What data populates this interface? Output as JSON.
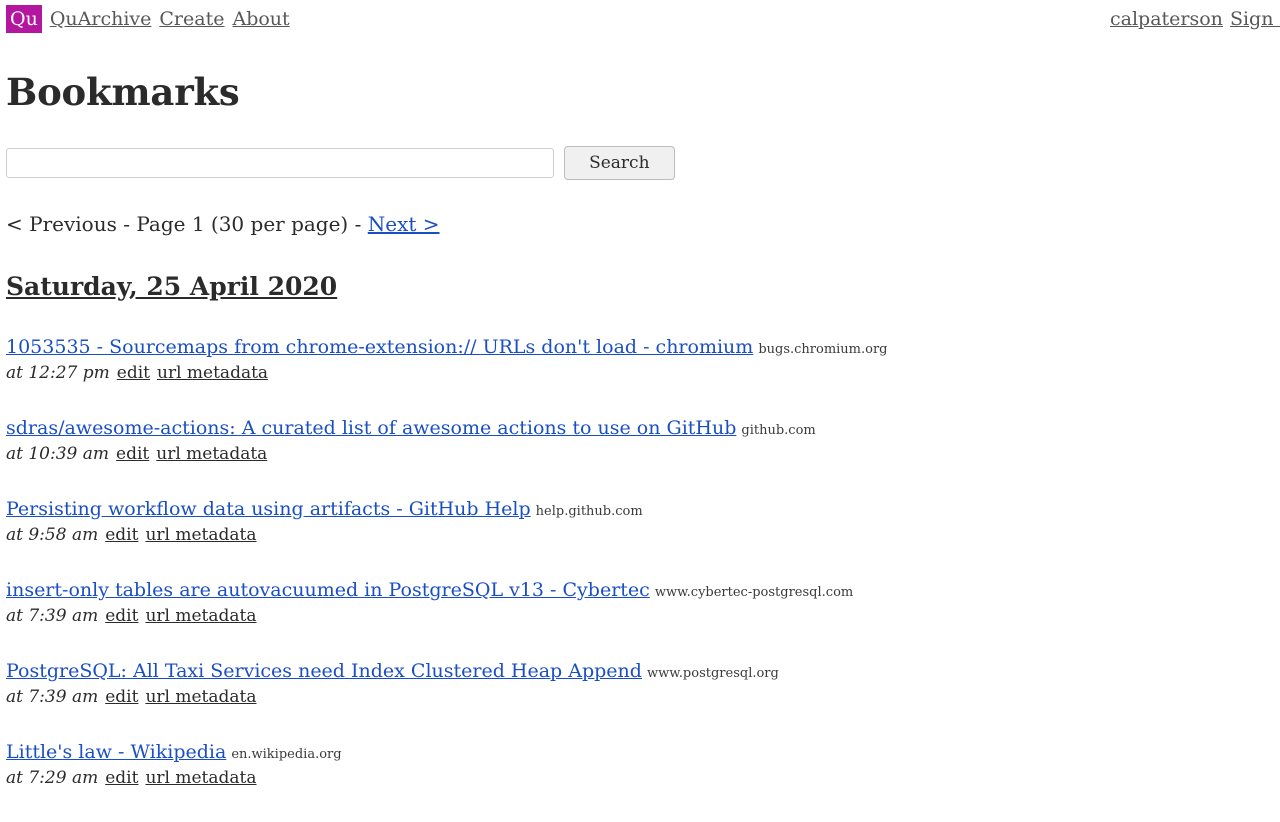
{
  "header": {
    "logo_text": "Qu",
    "logo_color": "#b3179f",
    "nav_left": [
      {
        "label": "QuArchive",
        "name": "nav-link-quarchive"
      },
      {
        "label": "Create",
        "name": "nav-link-create"
      },
      {
        "label": "About",
        "name": "nav-link-about"
      }
    ],
    "nav_right": [
      {
        "label": "calpaterson",
        "name": "nav-link-username"
      },
      {
        "label": "Sign out",
        "name": "nav-link-sign-out"
      }
    ]
  },
  "page_title": "Bookmarks",
  "search": {
    "value": "",
    "placeholder": "",
    "button_label": "Search"
  },
  "pagination": {
    "previous_label": "< Previous",
    "separator_left": " - ",
    "page_label": "Page 1 (30 per page)",
    "separator_right": " - ",
    "next_label": "Next >"
  },
  "date_heading": "Saturday, 25 April 2020",
  "actions": {
    "edit_label": "edit",
    "url_metadata_label": "url metadata"
  },
  "bookmarks": [
    {
      "title": "1053535 - Sourcemaps from chrome-extension:// URLs don't load - chromium",
      "domain": "bugs.chromium.org",
      "time": "at 12:27 pm"
    },
    {
      "title": "sdras/awesome-actions: A curated list of awesome actions to use on GitHub",
      "domain": "github.com",
      "time": "at 10:39 am"
    },
    {
      "title": "Persisting workflow data using artifacts - GitHub Help",
      "domain": "help.github.com",
      "time": "at 9:58 am"
    },
    {
      "title": "insert-only tables are autovacuumed in PostgreSQL v13 - Cybertec",
      "domain": "www.cybertec-postgresql.com",
      "time": "at 7:39 am"
    },
    {
      "title": "PostgreSQL: All Taxi Services need Index Clustered Heap Append",
      "domain": "www.postgresql.org",
      "time": "at 7:39 am"
    },
    {
      "title": "Little's law - Wikipedia",
      "domain": "en.wikipedia.org",
      "time": "at 7:29 am"
    }
  ]
}
